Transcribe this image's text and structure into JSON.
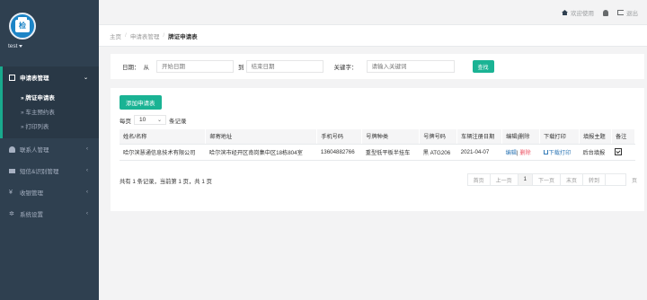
{
  "sidebar": {
    "user": "test",
    "logo_text": "检",
    "menu": [
      {
        "label": "申请表管理",
        "active": true,
        "arrow": "⌄",
        "items": [
          {
            "label": "» 牌证申请表",
            "active": true
          },
          {
            "label": "» 车主预约表",
            "active": false
          },
          {
            "label": "» 打印列表",
            "active": false
          }
        ]
      },
      {
        "label": "联系人管理",
        "arrow": "‹"
      },
      {
        "label": "短信&识别管理",
        "arrow": "‹"
      },
      {
        "label": "收银管理",
        "arrow": "‹"
      },
      {
        "label": "系统设置",
        "arrow": "‹"
      }
    ]
  },
  "topbar": {
    "welcome": "欢迎使用",
    "logout": "退出"
  },
  "breadcrumb": {
    "home": "主页",
    "parent": "申请表管理",
    "current": "牌证申请表",
    "sep": "/"
  },
  "search": {
    "date_label": "日期：",
    "from_label": "从",
    "start_placeholder": "开始日期",
    "to_label": "到",
    "end_placeholder": "结束日期",
    "keyword_label": "关键字：",
    "keyword_placeholder": "请输入关键词",
    "button": "查找"
  },
  "main": {
    "add_button": "添加申请表",
    "perpage_prefix": "每页",
    "perpage_value": "10",
    "perpage_suffix": "条记录",
    "columns": [
      "姓名/名称",
      "邮寄地址",
      "手机号码",
      "号牌种类",
      "号牌号码",
      "车辆注册日期",
      "编辑|删除",
      "下载打印",
      "填报主题",
      "备注"
    ],
    "rows": [
      {
        "name": "哈尔滨慧通信息技术有限公司",
        "address": "哈尔滨市经开区南岗集中区18栋804室",
        "phone": "13604882766",
        "plate_type": "重型低平板半挂车",
        "plate_no": "黑 ATG206",
        "reg_date": "2021-04-07",
        "edit": "编辑",
        "sep": "|",
        "delete": "删除",
        "download": "下载打印",
        "subject": "后台填报"
      }
    ],
    "summary": "共有 1 条记录，当前第 1 页，共 1 页",
    "pager": {
      "first": "首页",
      "prev": "上一页",
      "current": "1",
      "next": "下一页",
      "last": "末页",
      "jump": "转到",
      "tail": "页"
    }
  }
}
